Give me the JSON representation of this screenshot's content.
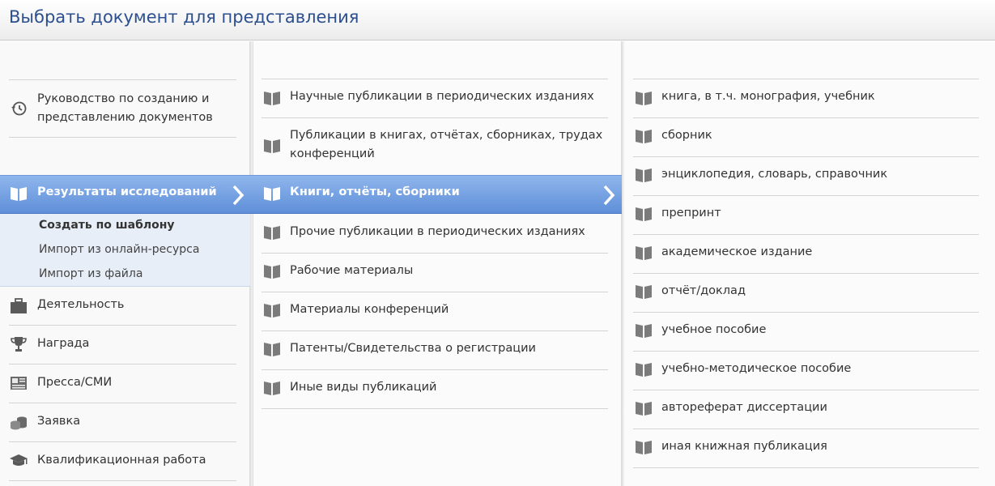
{
  "header": {
    "title": "Выбрать документ для представления"
  },
  "col1": {
    "guide": "Руководство по созданию и представлению документов",
    "guide_line1": "Руководство по созданию и",
    "guide_line2": "представлению документов",
    "selected": "Результаты исследований",
    "subitems": [
      "Создать по шаблону",
      "Импорт из онлайн-ресурса",
      "Импорт из файла"
    ],
    "items": [
      {
        "label": "Деятельность",
        "icon": "briefcase-icon"
      },
      {
        "label": "Награда",
        "icon": "trophy-icon"
      },
      {
        "label": "Пресса/СМИ",
        "icon": "newspaper-icon"
      },
      {
        "label": "Заявка",
        "icon": "coins-icon"
      },
      {
        "label": "Квалификационная работа",
        "icon": "graduation-cap-icon"
      }
    ]
  },
  "col2": {
    "items": [
      {
        "line1": "Научные публикации в периодических изданиях"
      },
      {
        "line1": "Публикации в книгах, отчётах, сборниках, трудах",
        "line2": "конференций"
      },
      {
        "line1": "Книги, отчёты, сборники",
        "selected": true
      },
      {
        "line1": "Прочие публикации в периодических изданиях"
      },
      {
        "line1": "Рабочие материалы"
      },
      {
        "line1": "Материалы конференций"
      },
      {
        "line1": "Патенты/Свидетельства о регистрации"
      },
      {
        "line1": "Иные виды публикаций"
      }
    ]
  },
  "col3": {
    "items": [
      "книга, в т.ч. монография, учебник",
      "сборник",
      "энциклопедия, словарь, справочник",
      "препринт",
      "академическое издание",
      "отчёт/доклад",
      "учебное пособие",
      "учебно-методическое пособие",
      "автореферат диссертации",
      "иная книжная публикация"
    ]
  },
  "colors": {
    "accent": "#6f9be0",
    "title": "#2c4f8f",
    "book_icon": "#7b7b7b"
  }
}
